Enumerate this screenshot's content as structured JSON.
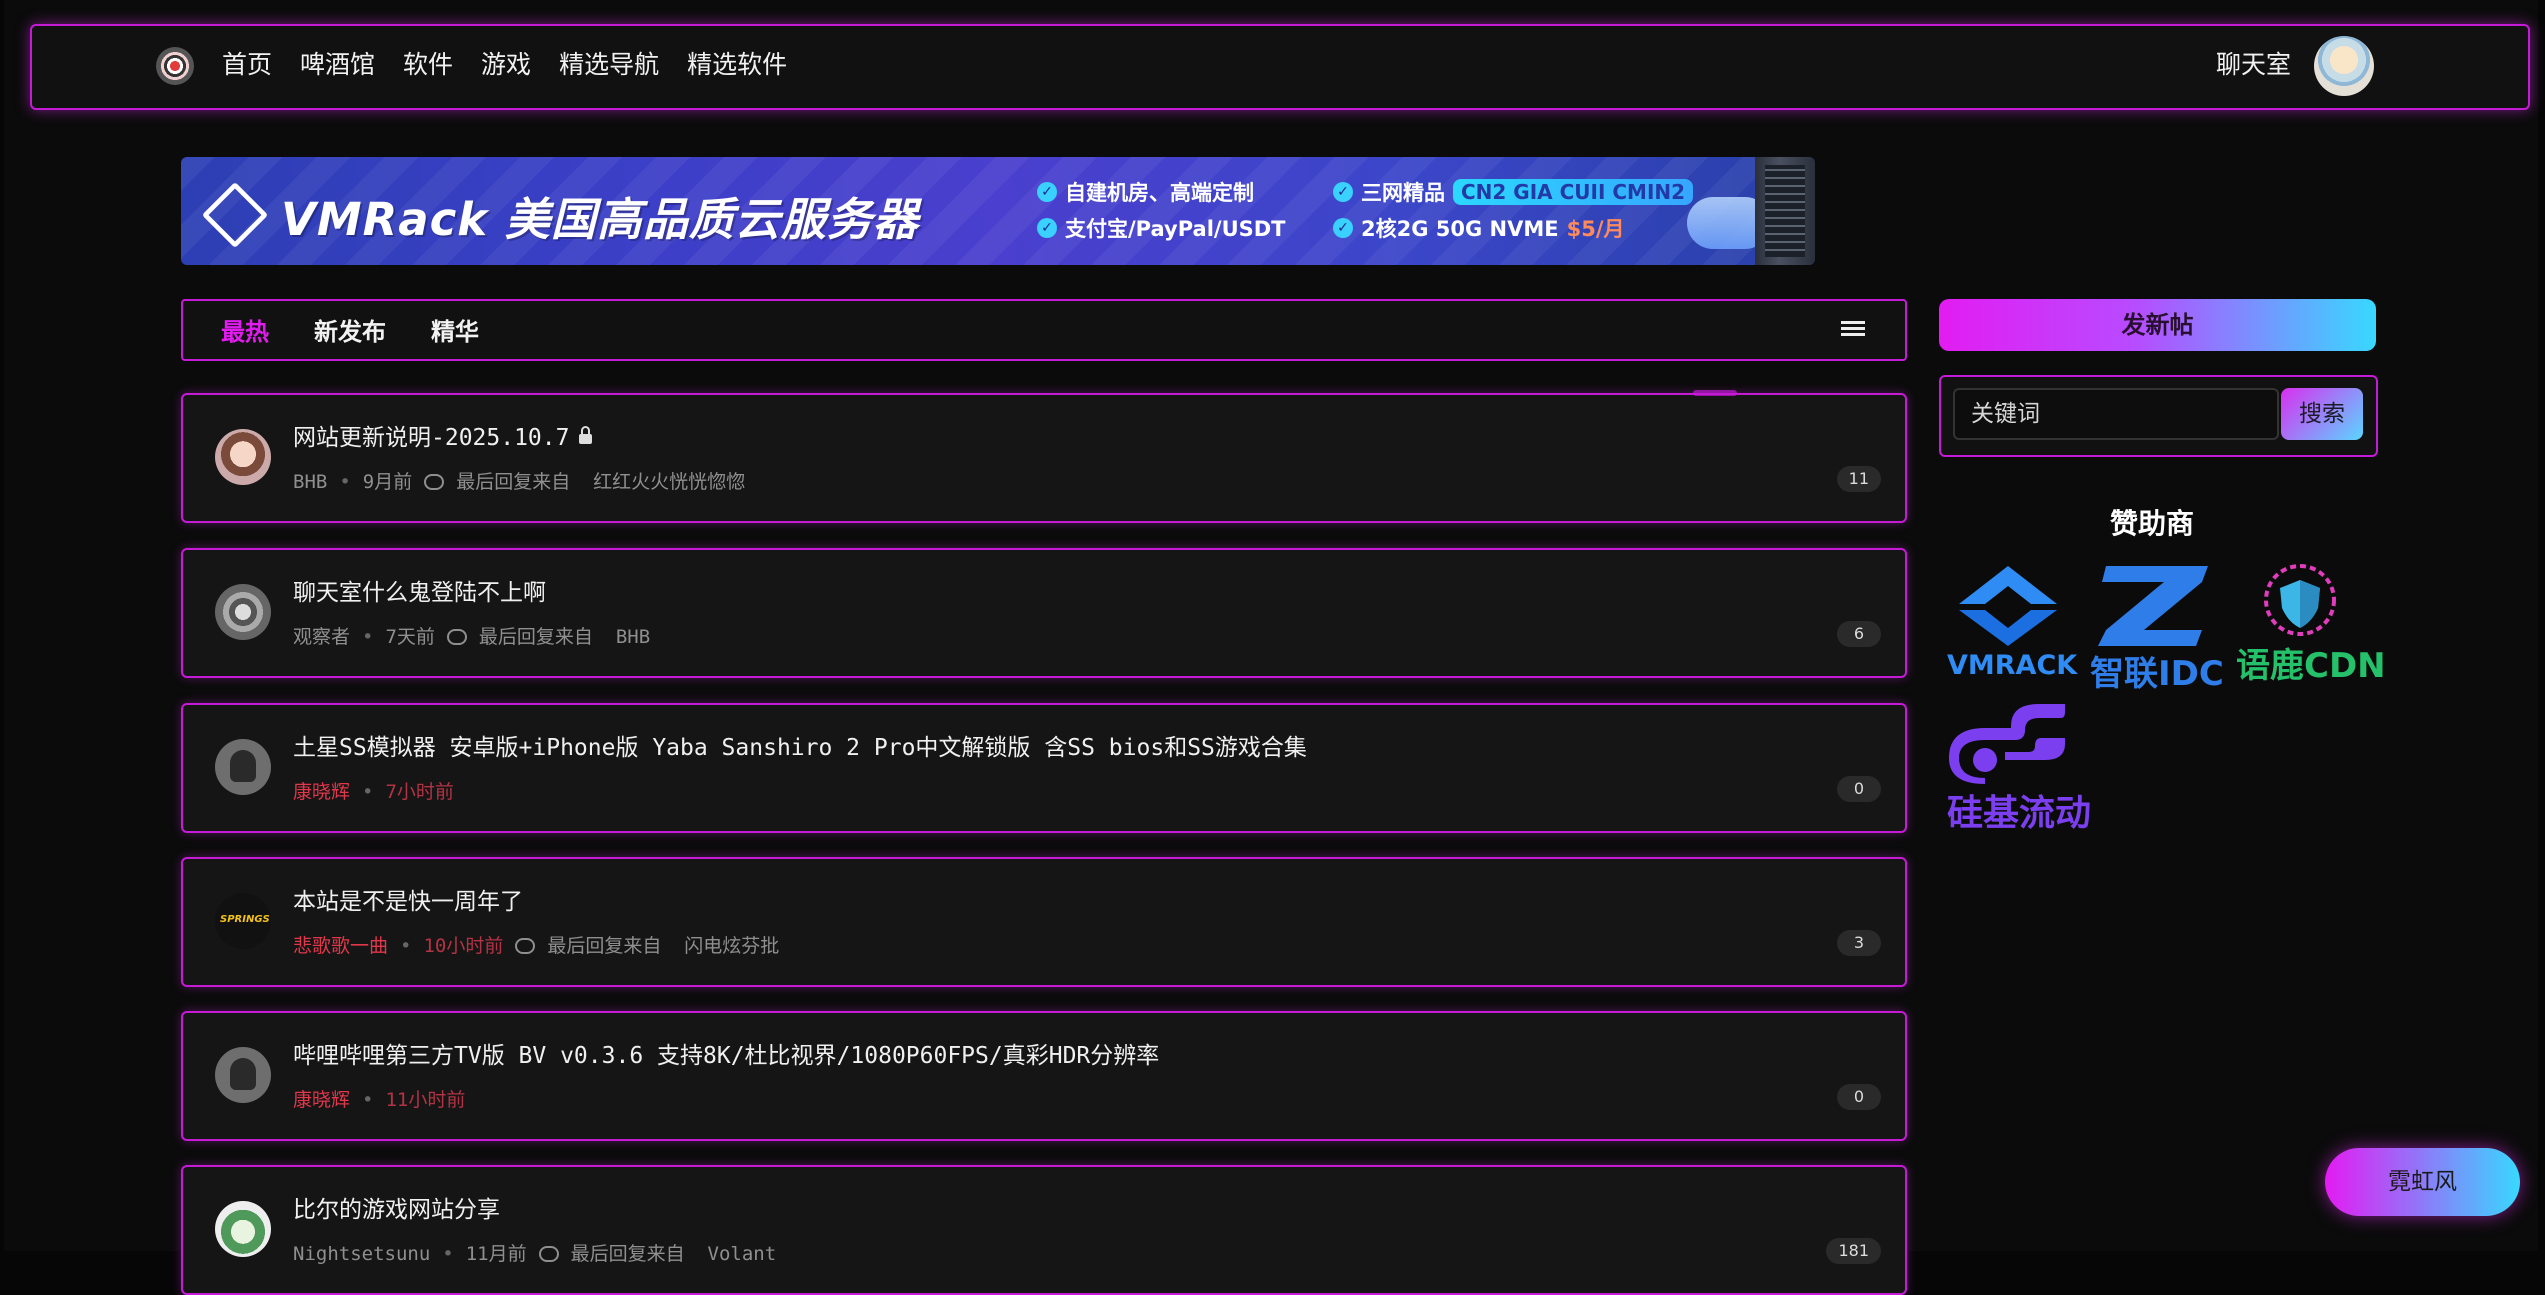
{
  "header": {
    "nav": [
      "首页",
      "啤酒馆",
      "软件",
      "游戏",
      "精选导航",
      "精选软件"
    ],
    "chat": "聊天室"
  },
  "banner": {
    "title": "VMRack 美国高品质云服务器",
    "feat1": "自建机房、高端定制",
    "feat2": "支付宝/PayPal/USDT",
    "feat3": "三网精品",
    "feat3_badge": "CN2 GIA CUII CMIN2",
    "feat4": "2核2G 50G NVME",
    "feat4_price": "$5/月"
  },
  "tabs": {
    "hot": "最热",
    "new": "新发布",
    "featured": "精华"
  },
  "posts": [
    {
      "title": "网站更新说明-2025.10.7",
      "author": "BHB",
      "time": "9月前",
      "last": "最后回复来自",
      "last_user": "红红火火恍恍惚惚",
      "count": "11"
    },
    {
      "title": "聊天室什么鬼登陆不上啊",
      "author": "观察者",
      "time": "7天前",
      "last": "最后回复来自",
      "last_user": "BHB",
      "count": "6"
    },
    {
      "title": "土星SS模拟器 安卓版+iPhone版 Yaba Sanshiro 2 Pro中文解锁版 含SS bios和SS游戏合集",
      "author": "康晓辉",
      "time": "7小时前",
      "count": "0"
    },
    {
      "title": "本站是不是快一周年了",
      "author": "悲歌歌一曲",
      "time": "10小时前",
      "last": "最后回复来自",
      "last_user": "闪电炫芬批",
      "count": "3"
    },
    {
      "title": "哔哩哔哩第三方TV版 BV v0.3.6 支持8K/杜比视界/1080P60FPS/真彩HDR分辨率",
      "author": "康晓辉",
      "time": "11小时前",
      "count": "0"
    },
    {
      "title": "比尔的游戏网站分享",
      "author": "Nightsetsunu",
      "time": "11月前",
      "last": "最后回复来自",
      "last_user": "Volant",
      "count": "181"
    }
  ],
  "sidebar": {
    "new_post": "发新帖",
    "search_placeholder": "关键词",
    "search_btn": "搜索",
    "sponsor_title": "赞助商",
    "sponsors": [
      "VMRACK",
      "智联IDC",
      "语鹿CDN",
      "硅基流动"
    ]
  },
  "float_btn": "霓虹风",
  "colors": {
    "accent": "#c51ad6",
    "active_tab": "#e21cf0",
    "gradient_end": "#38d8ff"
  }
}
